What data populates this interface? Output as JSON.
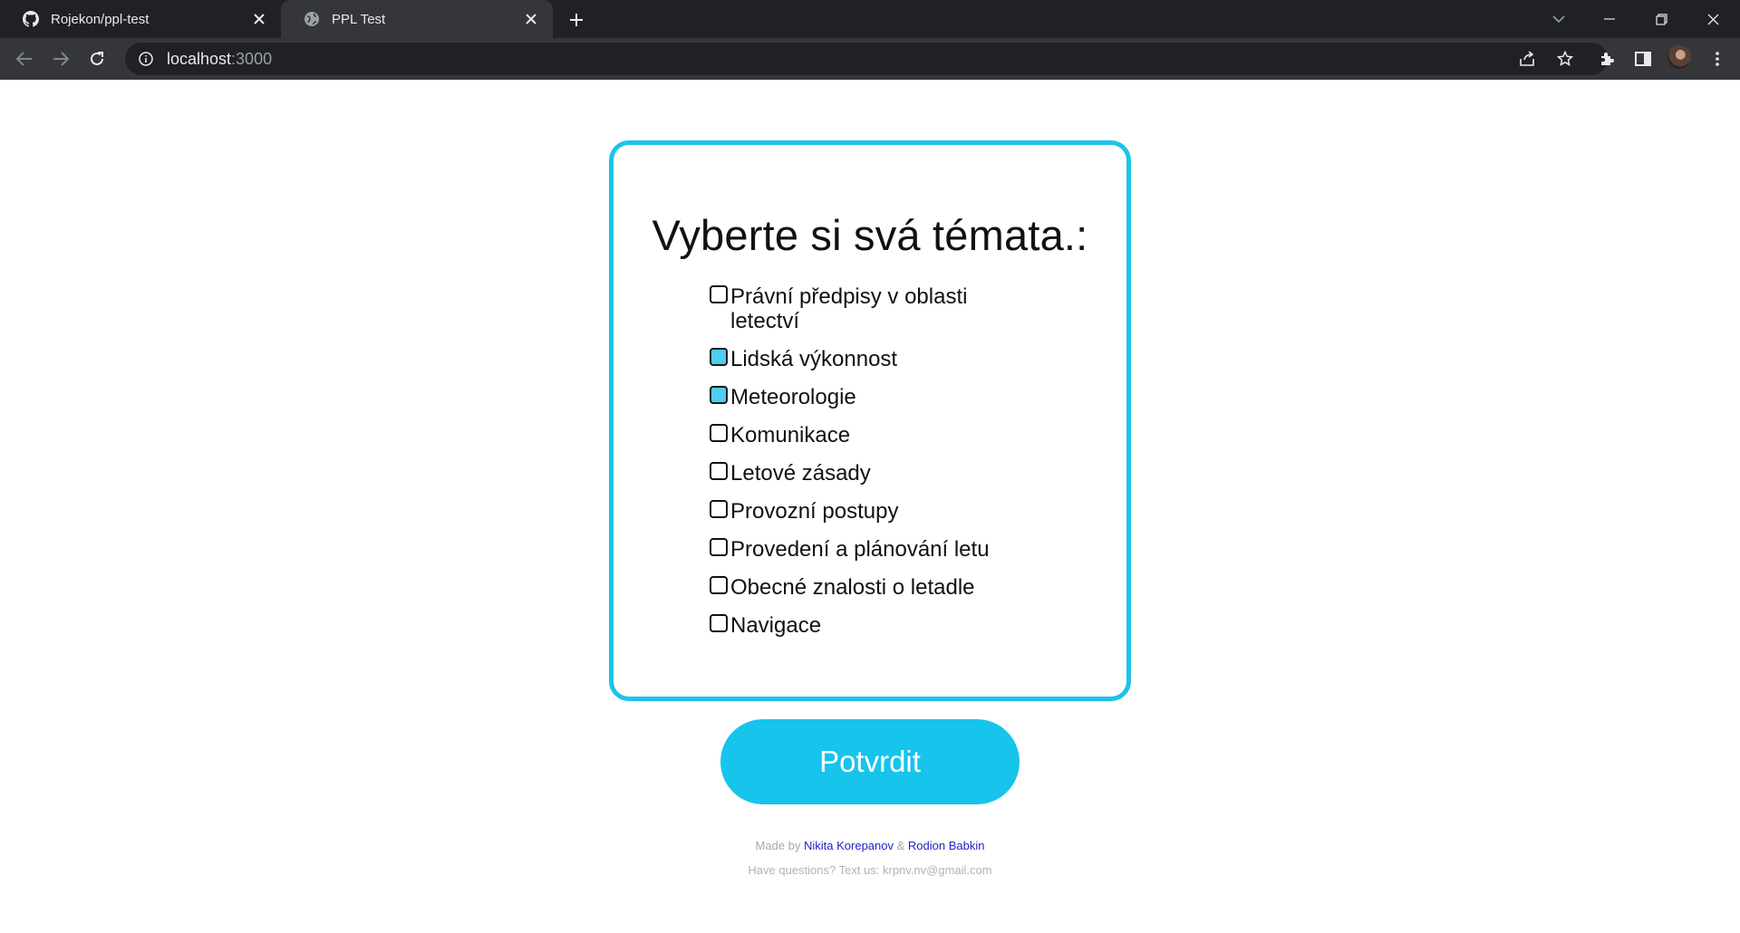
{
  "browser": {
    "tabs": [
      {
        "title": "Rojekon/ppl-test",
        "icon": "github-icon",
        "active": false
      },
      {
        "title": "PPL Test",
        "icon": "globe-icon",
        "active": true
      }
    ],
    "address": {
      "host": "localhost",
      "port": ":3000"
    }
  },
  "page": {
    "title": "Vyberte si svá témata.:",
    "topics": [
      {
        "label": "Právní předpisy v oblasti letectví",
        "checked": false
      },
      {
        "label": "Lidská výkonnost",
        "checked": true
      },
      {
        "label": "Meteorologie",
        "checked": true
      },
      {
        "label": "Komunikace",
        "checked": false
      },
      {
        "label": "Letové zásady",
        "checked": false
      },
      {
        "label": "Provozní postupy",
        "checked": false
      },
      {
        "label": "Provedení a plánování letu",
        "checked": false
      },
      {
        "label": "Obecné znalosti o letadle",
        "checked": false
      },
      {
        "label": "Navigace",
        "checked": false
      }
    ],
    "confirm_label": "Potvrdit",
    "footer": {
      "made_by": "Made by",
      "author1": "Nikita Korepanov",
      "and": "&",
      "author2": "Rodion Babkin",
      "contact": "Have questions? Text us: krpnv.nv@gmail.com"
    }
  },
  "colors": {
    "accent": "#1cc3ea",
    "checked_fill": "#4fcdf0",
    "link": "#2323c7"
  }
}
